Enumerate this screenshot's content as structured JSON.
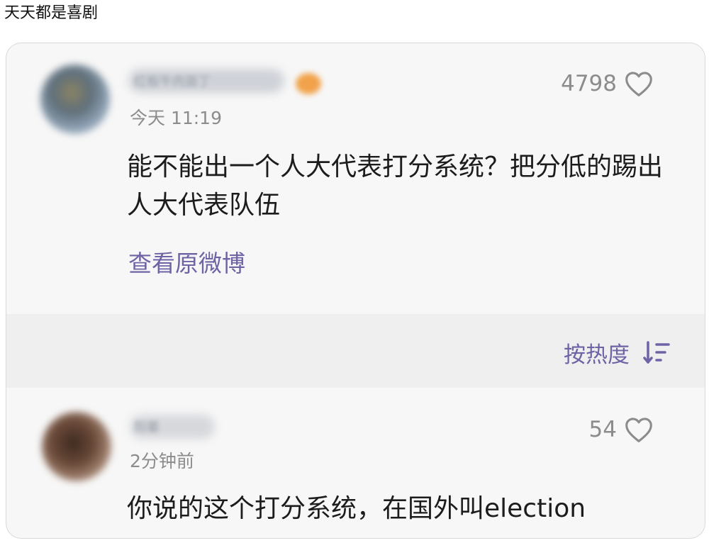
{
  "post": {
    "title": "天天都是喜剧"
  },
  "comments": [
    {
      "username": "红板牛肉面丁",
      "time": "今天 11:19",
      "likes": "4798",
      "text": "能不能出一个人大代表打分系统？把分低的踢出人大代表队伍",
      "view_original": "查看原微博"
    },
    {
      "username": "阳蓁",
      "time": "2分钟前",
      "likes": "54",
      "text": "你说的这个打分系统，在国外叫election"
    }
  ],
  "sort": {
    "label": "按热度",
    "icon": "sort-descending-icon"
  },
  "colors": {
    "accent": "#6f63a6",
    "meta": "#8c8c8c",
    "card_bg": "#f7f7f7",
    "sort_bg": "#efefef"
  }
}
